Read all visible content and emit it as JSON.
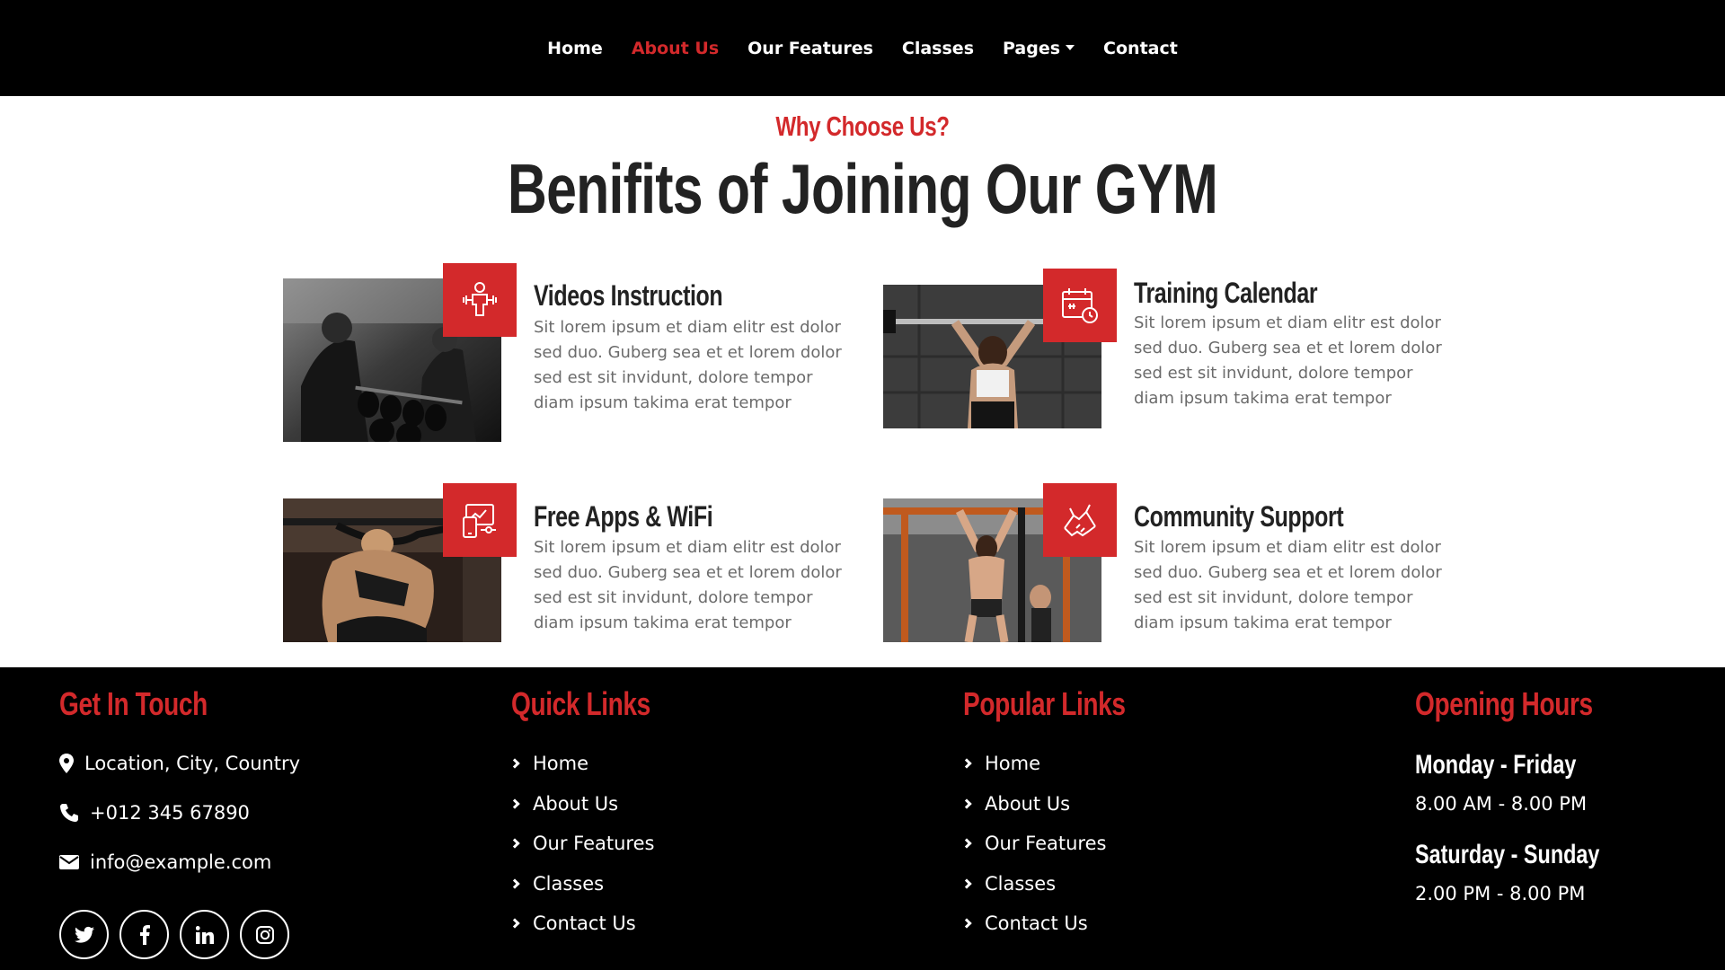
{
  "nav": {
    "items": [
      {
        "label": "Home"
      },
      {
        "label": "About Us"
      },
      {
        "label": "Our Features"
      },
      {
        "label": "Classes"
      },
      {
        "label": "Pages"
      },
      {
        "label": "Contact"
      }
    ],
    "active": "About Us"
  },
  "benefits": {
    "subtitle": "Why Choose Us?",
    "title": "Benifits of Joining Our GYM",
    "cards": [
      {
        "title": "Videos Instruction",
        "icon": "fitness-trainer-icon",
        "text": "Sit lorem ipsum et diam elitr est dolor sed duo. Guberg sea et et lorem dolor sed est sit invidunt, dolore tempor diam ipsum takima erat tempor"
      },
      {
        "title": "Training Calendar",
        "icon": "calendar-clock-icon",
        "text": "Sit lorem ipsum et diam elitr est dolor sed duo. Guberg sea et et lorem dolor sed est sit invidunt, dolore tempor diam ipsum takima erat tempor"
      },
      {
        "title": "Free Apps & WiFi",
        "icon": "mobile-app-icon",
        "text": "Sit lorem ipsum et diam elitr est dolor sed duo. Guberg sea et et lorem dolor sed est sit invidunt, dolore tempor diam ipsum takima erat tempor"
      },
      {
        "title": "Community Support",
        "icon": "handshake-icon",
        "text": "Sit lorem ipsum et diam elitr est dolor sed duo. Guberg sea et et lorem dolor sed est sit invidunt, dolore tempor diam ipsum takima erat tempor"
      }
    ]
  },
  "footer": {
    "touch": {
      "heading": "Get In Touch",
      "location": "Location, City, Country",
      "phone": "+012 345 67890",
      "email": "info@example.com",
      "social": [
        "twitter-icon",
        "facebook-icon",
        "linkedin-icon",
        "instagram-icon"
      ]
    },
    "quick": {
      "heading": "Quick Links",
      "links": [
        "Home",
        "About Us",
        "Our Features",
        "Classes",
        "Contact Us"
      ]
    },
    "popular": {
      "heading": "Popular Links",
      "links": [
        "Home",
        "About Us",
        "Our Features",
        "Classes",
        "Contact Us"
      ]
    },
    "hours": {
      "heading": "Opening Hours",
      "weekday_label": "Monday - Friday",
      "weekday_time": "8.00 AM - 8.00 PM",
      "weekend_label": "Saturday - Sunday",
      "weekend_time": "2.00 PM - 8.00 PM"
    }
  },
  "colors": {
    "accent": "#d3292b",
    "dark": "#000000",
    "heading": "#222222",
    "body_text": "#6b6b6b"
  }
}
